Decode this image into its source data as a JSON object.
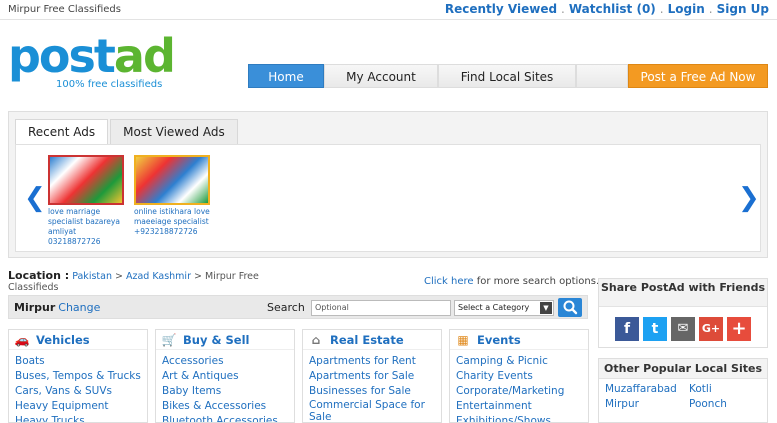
{
  "topbar": {
    "site_title": "Mirpur Free Classifieds",
    "links": [
      "Recently Viewed",
      "Watchlist",
      "(0)",
      "Login",
      "Sign Up"
    ]
  },
  "logo": {
    "text": "postad",
    "tagline": "100% free classifieds",
    "color_blue": "#1a8fd6",
    "color_green": "#5cb531"
  },
  "nav": {
    "items": [
      "Home",
      "My Account",
      "Find Local Sites"
    ],
    "active": "Home",
    "post_button": "Post a Free Ad Now"
  },
  "ads": {
    "tabs": [
      "Recent Ads",
      "Most Viewed Ads"
    ],
    "cards": [
      {
        "title": "love marriage specialist bazareya amliyat 03218872726"
      },
      {
        "title": "online istikhara love maeeiage specialist +923218872726"
      }
    ]
  },
  "location": {
    "label": "Location :",
    "crumbs": [
      "Pakistan",
      "Azad Kashmir"
    ],
    "current": "Mirpur Free Classifieds",
    "search_hint_link": "Click here",
    "search_hint_text": "for more search options."
  },
  "search": {
    "city": "Mirpur",
    "change_label": "Change",
    "label": "Search",
    "placeholder": "Optional",
    "category_default": "Select a Category"
  },
  "categories": [
    {
      "name": "Vehicles",
      "icon": "car-icon",
      "items": [
        "Boats",
        "Buses, Tempos & Trucks",
        "Cars, Vans & SUVs",
        "Heavy Equipment",
        "Heavy Trucks"
      ]
    },
    {
      "name": "Buy & Sell",
      "icon": "cart-icon",
      "items": [
        "Accessories",
        "Art & Antiques",
        "Baby Items",
        "Bikes & Accessories",
        "Bluetooth Accessories"
      ]
    },
    {
      "name": "Real Estate",
      "icon": "house-icon",
      "items": [
        "Apartments for Rent",
        "Apartments for Sale",
        "Businesses for Sale",
        "Commercial Space for Sale"
      ]
    },
    {
      "name": "Events",
      "icon": "calendar-icon",
      "items": [
        "Camping & Picnic",
        "Charity Events",
        "Corporate/Marketing",
        "Entertainment",
        "Exhibitions/Shows"
      ]
    }
  ],
  "share": {
    "title": "Share PostAd with Friends",
    "icons": [
      {
        "name": "facebook-icon",
        "glyph": "f",
        "color": "#3b5998"
      },
      {
        "name": "twitter-icon",
        "glyph": "t",
        "color": "#1da1f2"
      },
      {
        "name": "email-icon",
        "glyph": "✉",
        "color": "#666666"
      },
      {
        "name": "googleplus-icon",
        "glyph": "G+",
        "color": "#dd4b39"
      },
      {
        "name": "more-icon",
        "glyph": "+",
        "color": "#e74c3c"
      }
    ]
  },
  "popular": {
    "title": "Other Popular Local Sites",
    "sites": [
      "Muzaffarabad",
      "Kotli",
      "Mirpur",
      "Poonch"
    ]
  }
}
